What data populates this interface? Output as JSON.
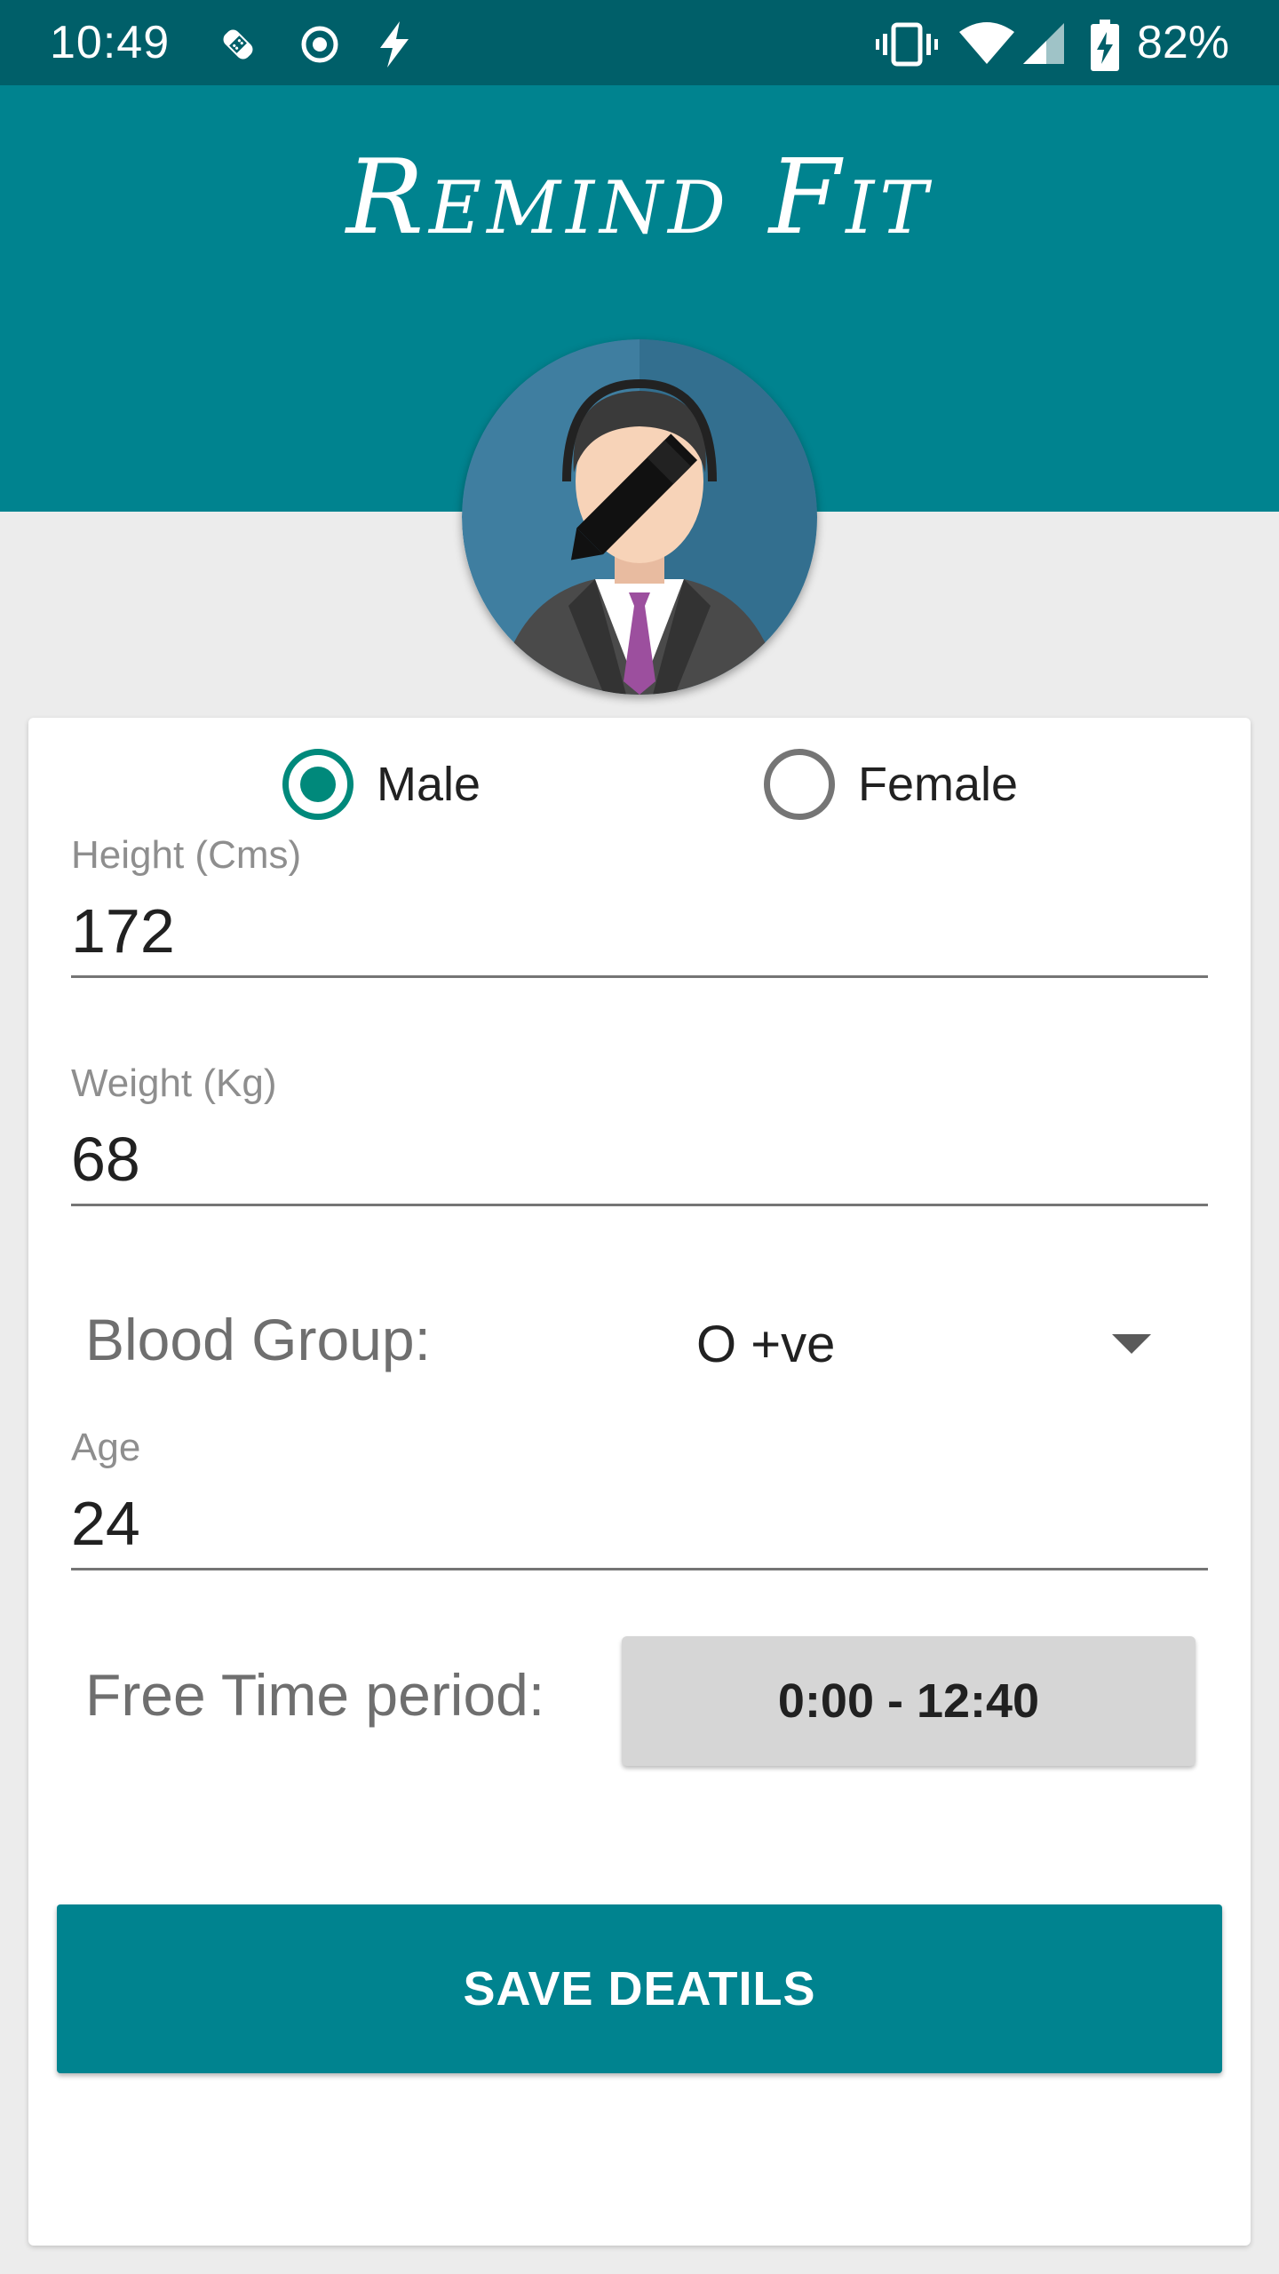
{
  "status_bar": {
    "time": "10:49",
    "battery": "82%",
    "icons": [
      "bandage-icon",
      "record-icon",
      "flash-icon",
      "vibrate-icon",
      "wifi-icon",
      "signal-icon",
      "battery-charging-icon"
    ]
  },
  "header": {
    "title": "Remind Fit",
    "background_color": "#00838f"
  },
  "avatar": {
    "icon": "male-avatar-icon",
    "edit_icon": "pencil-edit-icon"
  },
  "gender": {
    "options": [
      {
        "label": "Male",
        "selected": true
      },
      {
        "label": "Female",
        "selected": false
      }
    ]
  },
  "height": {
    "label": "Height (Cms)",
    "value": "172"
  },
  "weight": {
    "label": "Weight (Kg)",
    "value": "68"
  },
  "blood_group": {
    "label": "Blood Group:",
    "value": "O +ve"
  },
  "age": {
    "label": "Age",
    "value": "24"
  },
  "free_time": {
    "label": "Free Time period:",
    "value": "0:00 - 12:40"
  },
  "save_button": {
    "label": "SAVE DEATILS"
  },
  "colors": {
    "status_bar": "#005f69",
    "primary": "#00838f",
    "radio_accent": "#00897b"
  }
}
